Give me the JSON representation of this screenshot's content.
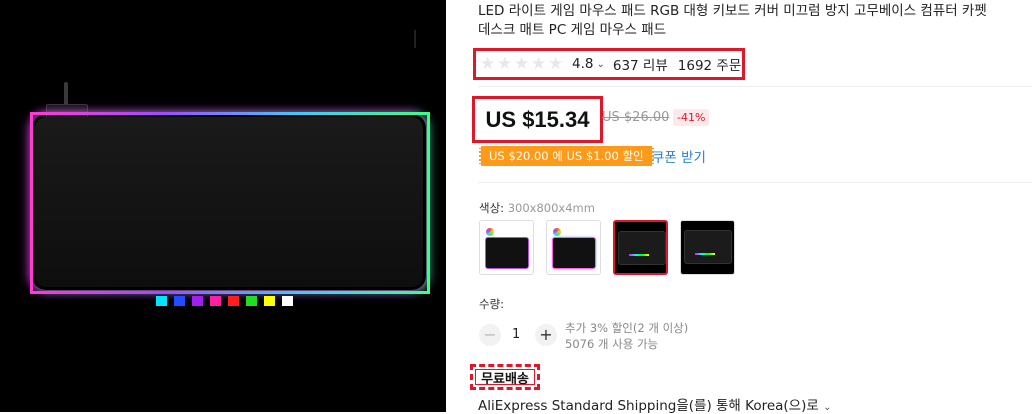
{
  "product": {
    "title_line1": "LED 라이트 게임 마우스 패드 RGB 대형 키보드 커버 미끄럼 방지 고무베이스 컴퓨터 카펫",
    "title_line2": "데스크 매트 PC 게임 마우스 패드"
  },
  "rating": {
    "value": "4.8",
    "reviews": "637 리뷰",
    "orders": "1692 주문",
    "stars": 5
  },
  "price": {
    "current": "US $15.34",
    "original": "US $26.00",
    "discount": "-41%"
  },
  "coupon": {
    "text": "US $20.00 에 US $1.00 할인",
    "link": "쿠폰 받기"
  },
  "color": {
    "label": "색상:",
    "value": "300x800x4mm",
    "selected_index": 2
  },
  "quantity": {
    "label": "수량:",
    "value": "1",
    "minus": "−",
    "plus": "+",
    "discount_info": "추가 3% 할인(2 개 이상)",
    "available": "5076 개 사용 가능"
  },
  "shipping": {
    "badge": "무료배송",
    "method": "AliExpress Standard Shipping을(를) 통해 Korea(으)로"
  },
  "led_colors": [
    "#00e5ff",
    "#1f4dff",
    "#a020f0",
    "#ff1fa2",
    "#ff1f1f",
    "#22dd22",
    "#ffff00",
    "#ffffff"
  ],
  "accent": "#e0162b"
}
